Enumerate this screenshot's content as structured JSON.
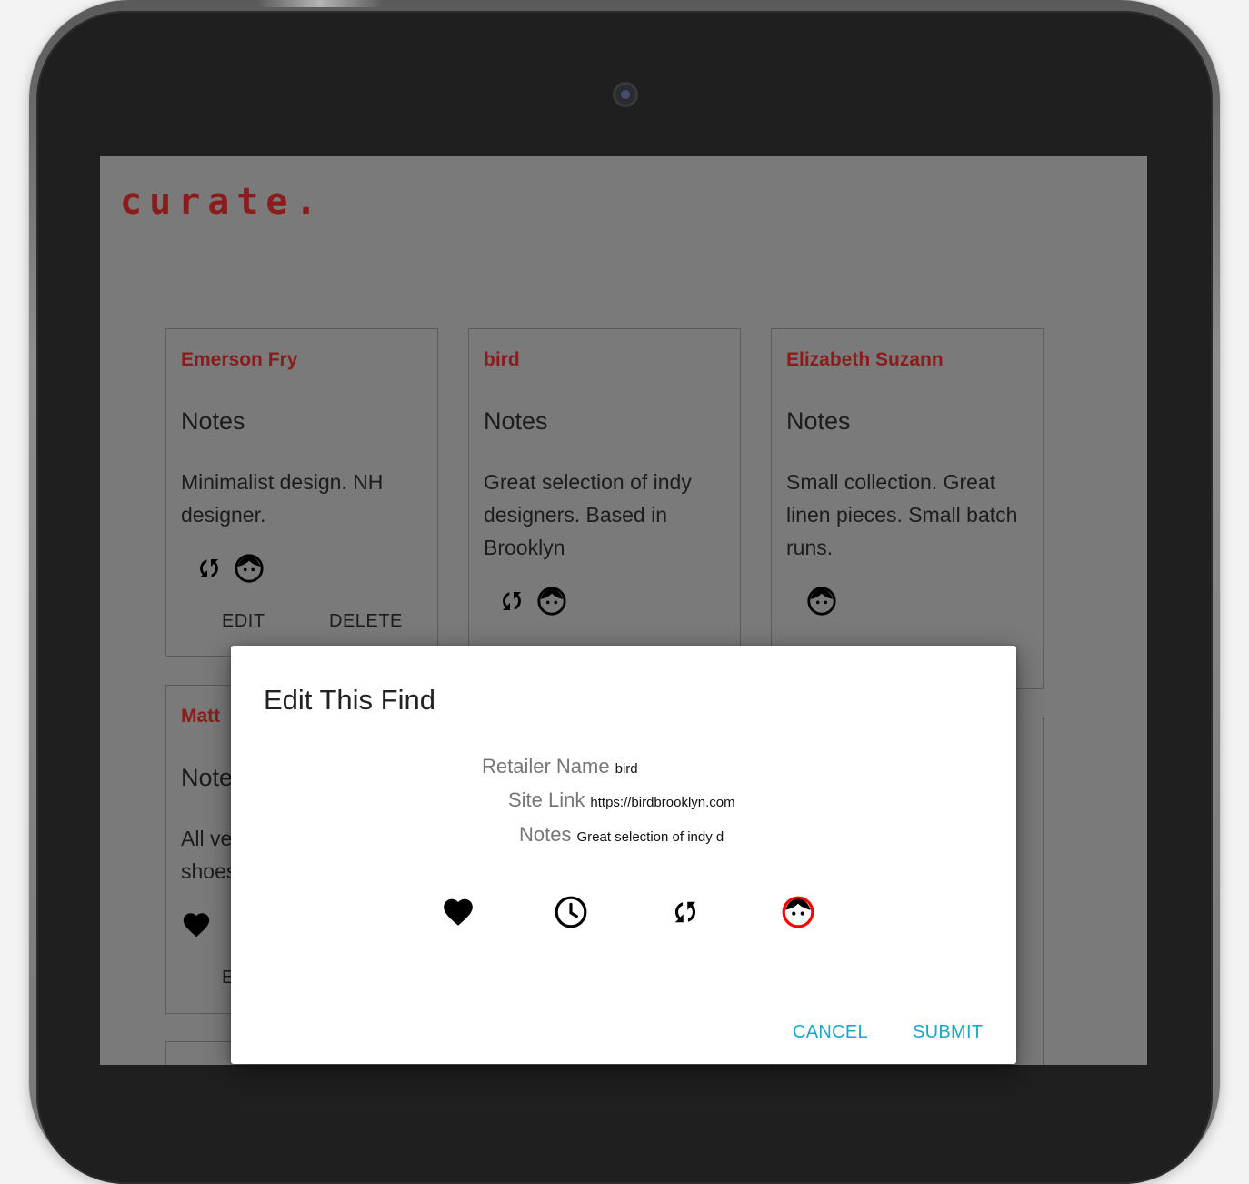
{
  "app": {
    "logo": "curate."
  },
  "cards": [
    {
      "title": "Emerson Fry",
      "notes_heading": "Notes",
      "notes": "Minimalist design. NH designer.",
      "icons": [
        "sync-icon",
        "face-icon"
      ],
      "actions": {
        "edit": "EDIT",
        "delete": "DELETE"
      }
    },
    {
      "title": "bird",
      "notes_heading": "Notes",
      "notes": "Great selection of indy designers. Based in Brooklyn",
      "icons": [
        "sync-icon",
        "face-icon"
      ]
    },
    {
      "title": "Elizabeth Suzann",
      "notes_heading": "Notes",
      "notes": "Small collection. Great linen pieces. Small batch runs.",
      "icons": [
        "face-icon"
      ]
    },
    {
      "title": "Matt",
      "notes_heading": "Note",
      "notes_line1": "All ve",
      "notes_line2": "shoes",
      "icons": [
        "heart-icon"
      ],
      "actions": {
        "edit": "E"
      }
    }
  ],
  "dialog": {
    "title": "Edit This Find",
    "fields": {
      "retailer_name": {
        "label": "Retailer Name",
        "value": "bird"
      },
      "site_link": {
        "label": "Site Link",
        "value": "https://birdbrooklyn.com"
      },
      "notes": {
        "label": "Notes",
        "value": "Great selection of indy designers. Based in Brooklyn"
      }
    },
    "icons": [
      {
        "name": "heart-icon",
        "color": "#000000"
      },
      {
        "name": "clock-icon",
        "color": "#000000"
      },
      {
        "name": "sync-icon",
        "color": "#ff0000"
      },
      {
        "name": "face-icon",
        "color": "#ff0000"
      }
    ],
    "cancel_label": "CANCEL",
    "submit_label": "SUBMIT"
  }
}
